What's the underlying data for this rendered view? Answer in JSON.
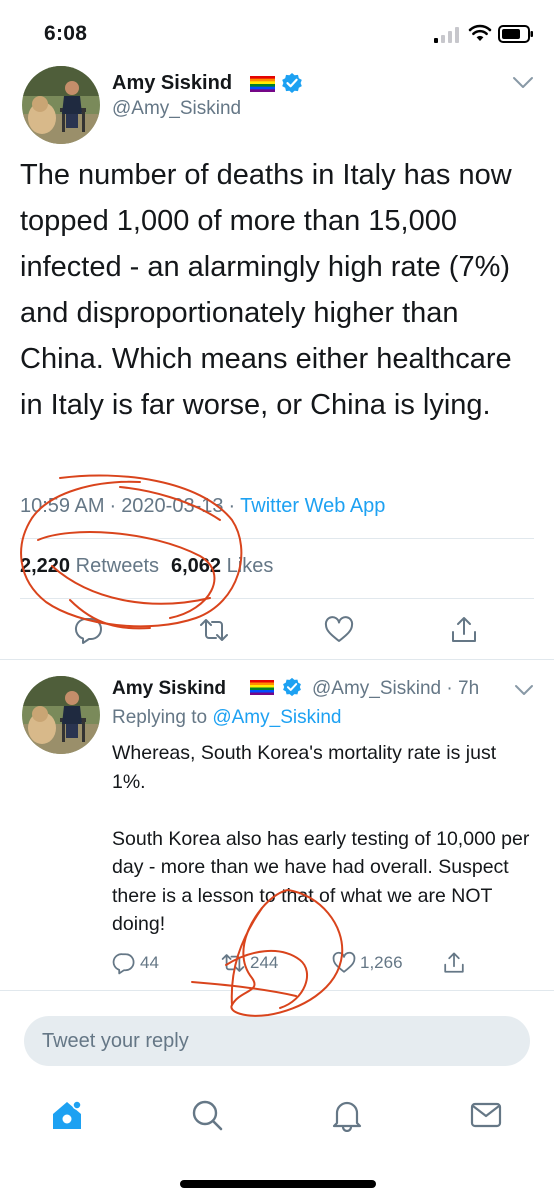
{
  "status_bar": {
    "time": "6:08",
    "icons": [
      "cellular-signal-icon",
      "wifi-icon",
      "battery-icon"
    ]
  },
  "main_tweet": {
    "author_name": "Amy Siskind",
    "author_handle": "@Amy_Siskind",
    "text": "The number of deaths in Italy has now topped 1,000 of more than 15,000 infected - an alarmingly high rate (7%) and disproportionately higher than China.  Which means either healthcare in Italy is far worse, or China is lying.",
    "time": "10:59 AM",
    "date": "2020-03-13",
    "separator": "·",
    "source": "Twitter Web App",
    "retweets_count": "2,220",
    "retweets_label": "Retweets",
    "likes_count": "6,062",
    "likes_label": "Likes",
    "actions": [
      "reply-icon",
      "retweet-icon",
      "like-icon",
      "share-icon"
    ]
  },
  "reply_tweet": {
    "author_name": "Amy Siskind",
    "author_handle": "@Amy_Siskind",
    "time_ago": "· 7h",
    "replying_prefix": "Replying to",
    "replying_to": "@Amy_Siskind",
    "paragraph_1": "Whereas, South Korea's mortality rate is just 1%.",
    "paragraph_2": "South Korea also has early testing of 10,000 per day - more than we have had overall.  Suspect there is a lesson to that of what we are NOT doing!",
    "reply_count": "44",
    "retweet_count": "244",
    "like_count": "1,266"
  },
  "composer": {
    "placeholder": "Tweet your reply"
  },
  "tab_bar": {
    "tabs": [
      "home-icon",
      "search-icon",
      "notifications-icon",
      "messages-icon"
    ],
    "active": "home"
  },
  "colors": {
    "accent": "#1da1f2",
    "secondary_text": "#657786",
    "primary_text": "#14171a",
    "divider": "#e1e8ed",
    "annotation": "#d9441c"
  }
}
